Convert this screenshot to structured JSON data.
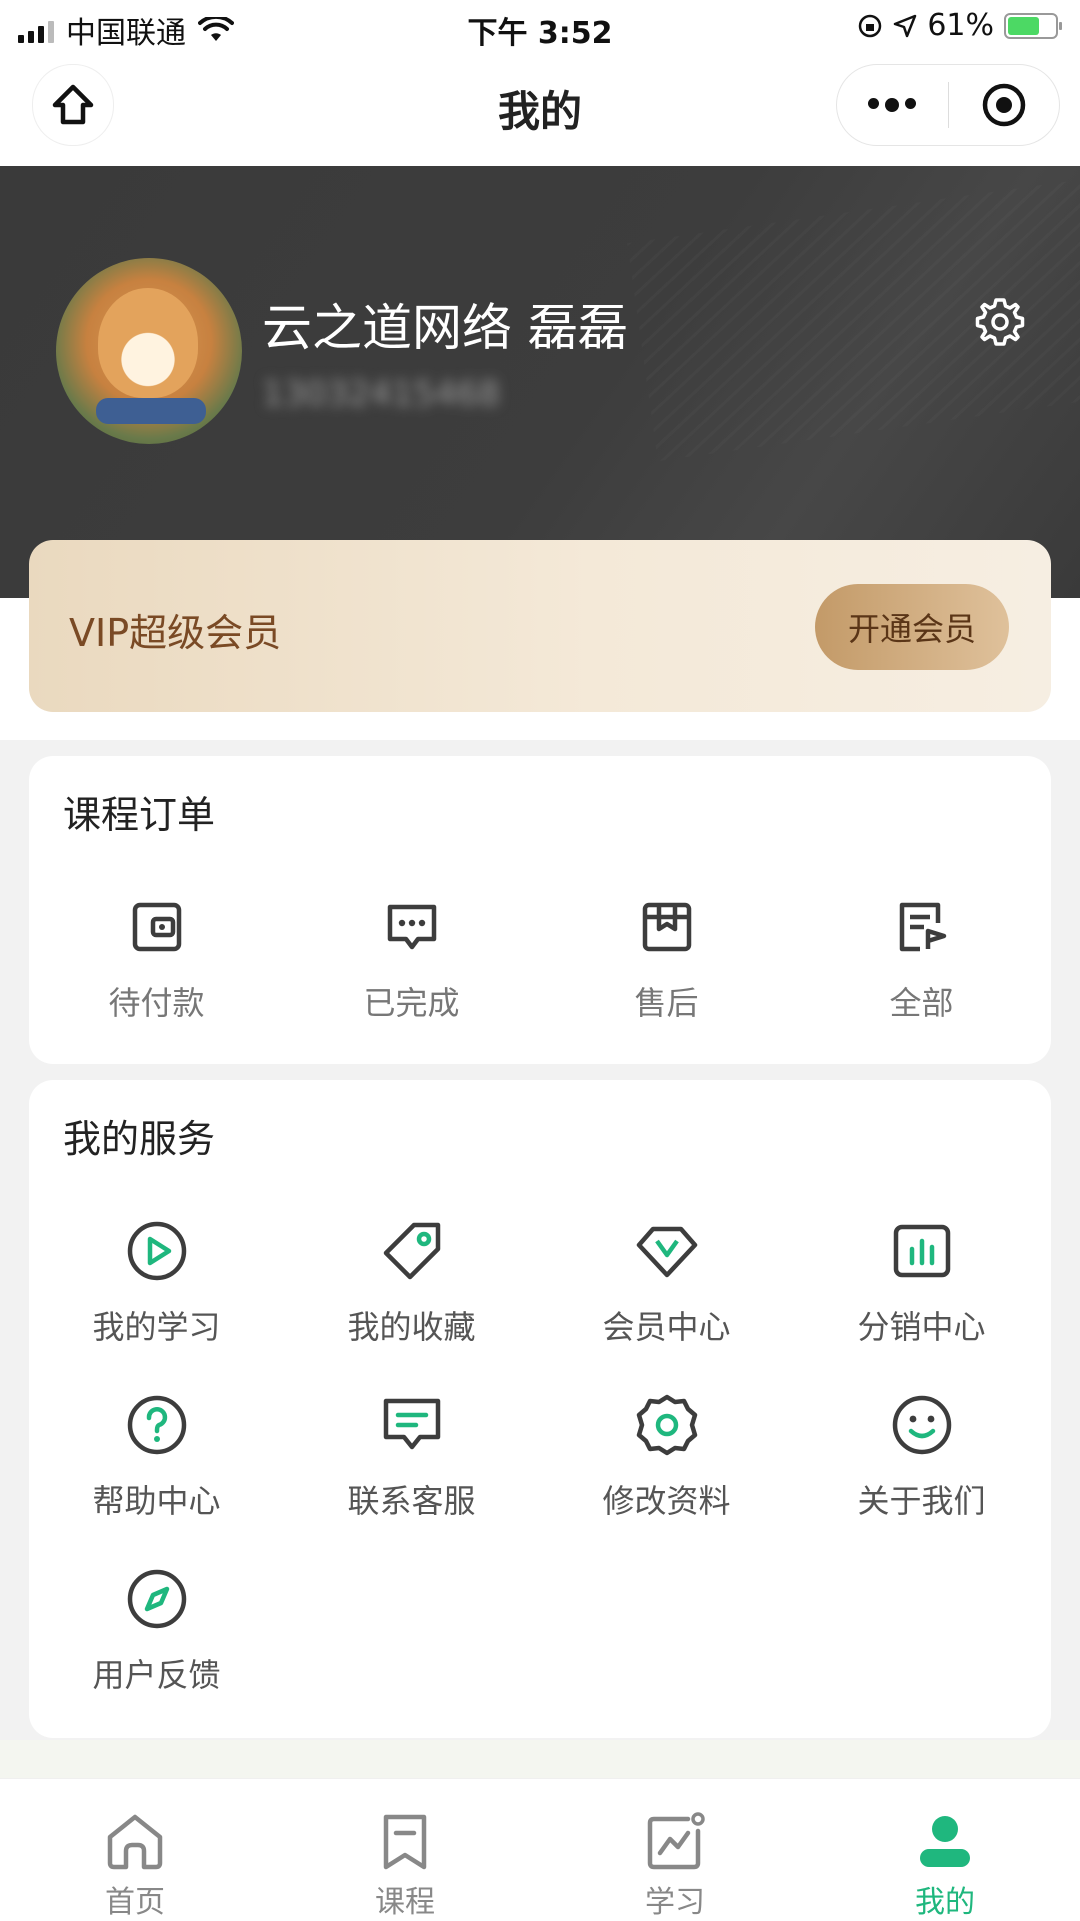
{
  "status_bar": {
    "carrier": "中国联通",
    "time": "下午 3:52",
    "battery": "61%"
  },
  "nav": {
    "title": "我的",
    "home_icon": "home-icon",
    "more_icon": "more-dots-icon",
    "close_icon": "target-circle-icon"
  },
  "profile": {
    "name": "云之道网络 磊磊",
    "phone": "13032415468"
  },
  "vip": {
    "label": "VIP超级会员",
    "button": "开通会员"
  },
  "orders": {
    "title": "课程订单",
    "items": [
      {
        "label": "待付款",
        "icon": "wallet-icon"
      },
      {
        "label": "已完成",
        "icon": "chat-dots-icon"
      },
      {
        "label": "售后",
        "icon": "box-icon"
      },
      {
        "label": "全部",
        "icon": "list-flag-icon"
      }
    ]
  },
  "services": {
    "title": "我的服务",
    "items": [
      {
        "label": "我的学习",
        "icon": "play-circle-icon"
      },
      {
        "label": "我的收藏",
        "icon": "tag-icon"
      },
      {
        "label": "会员中心",
        "icon": "vip-diamond-icon"
      },
      {
        "label": "分销中心",
        "icon": "bar-chart-icon"
      },
      {
        "label": "帮助中心",
        "icon": "help-circle-icon"
      },
      {
        "label": "联系客服",
        "icon": "message-icon"
      },
      {
        "label": "修改资料",
        "icon": "gear-icon"
      },
      {
        "label": "关于我们",
        "icon": "smiley-icon"
      },
      {
        "label": "用户反馈",
        "icon": "compass-icon"
      }
    ]
  },
  "tabs": [
    {
      "label": "首页",
      "icon": "home-outline-icon",
      "active": false
    },
    {
      "label": "课程",
      "icon": "bookmark-icon",
      "active": false
    },
    {
      "label": "学习",
      "icon": "trend-icon",
      "active": false
    },
    {
      "label": "我的",
      "icon": "person-icon",
      "active": true
    }
  ],
  "colors": {
    "accent": "#1fb77e",
    "icon_stroke": "#3d3d3d",
    "hero_bg": "#3c3c3c",
    "vip_text": "#7a4a25"
  }
}
